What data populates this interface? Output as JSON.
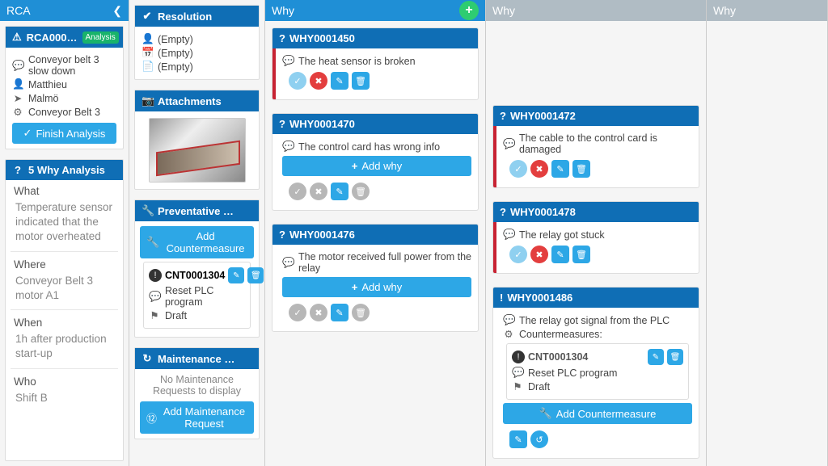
{
  "left": {
    "header": "RCA",
    "rca": {
      "id": "RCA000…",
      "status": "Analysis"
    },
    "summary": {
      "issue": "Conveyor belt 3 slow down",
      "user": "Matthieu",
      "site": "Malmö",
      "equipment": "Conveyor Belt 3"
    },
    "finish_btn": "Finish Analysis",
    "analysis_title": "5 Why Analysis",
    "sections": {
      "what_label": "What",
      "what_text": "Temperature sensor indicated that the motor overheated",
      "where_label": "Where",
      "where_text": "Conveyor Belt 3 motor A1",
      "when_label": "When",
      "when_text": "1h after production start-up",
      "who_label": "Who",
      "who_text": "Shift B"
    }
  },
  "mid": {
    "resolution": {
      "title": "Resolution",
      "user": "(Empty)",
      "date": "(Empty)",
      "note": "(Empty)"
    },
    "attachments": {
      "title": "Attachments"
    },
    "prevent": {
      "title": "Preventative …",
      "add_btn": "Add Countermeasure"
    },
    "cm": {
      "id": "CNT0001304",
      "desc": "Reset PLC program",
      "status": "Draft"
    },
    "maint": {
      "title": "Maintenance …",
      "empty": "No Maintenance Requests to display",
      "add_btn": "Add Maintenance Request"
    }
  },
  "why_headers": [
    "Why",
    "Why",
    "Why"
  ],
  "add_why": "Add why",
  "add_cm": "Add Countermeasure",
  "col1": {
    "c1": {
      "id": "WHY0001450",
      "text": "The heat sensor is broken"
    },
    "c2": {
      "id": "WHY0001470",
      "text": "The control card has wrong info"
    },
    "c3": {
      "id": "WHY0001476",
      "text": "The motor received full power from the relay"
    }
  },
  "col2": {
    "c1": {
      "id": "WHY0001472",
      "text": "The cable to the control card is damaged"
    },
    "c2": {
      "id": "WHY0001478",
      "text": "The relay got stuck"
    },
    "c3": {
      "id": "WHY0001486",
      "text": "The relay got signal from the PLC",
      "cm_label": "Countermeasures:",
      "cm": {
        "id": "CNT0001304",
        "desc": "Reset PLC program",
        "status": "Draft"
      }
    }
  }
}
